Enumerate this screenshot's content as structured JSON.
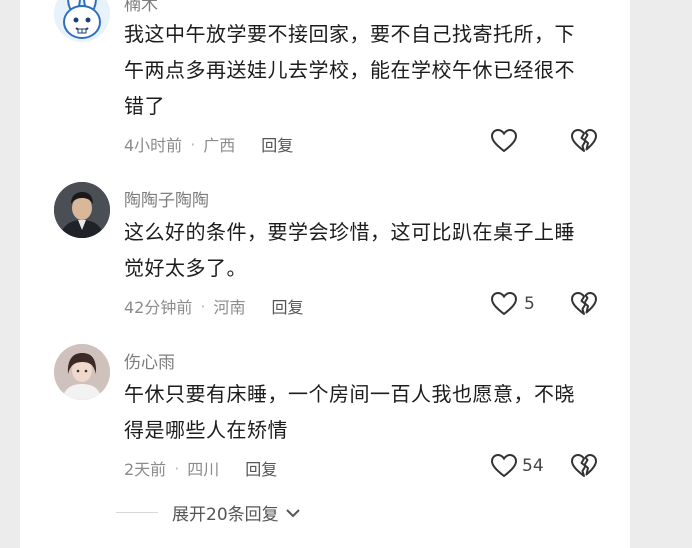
{
  "comments": [
    {
      "username": "楠木",
      "text": "我这中午放学要不接回家，要不自己找寄托所，下午两点多再送娃儿去学校，能在学校午休已经很不错了",
      "time": "4小时前",
      "location": "广西",
      "reply_label": "回复",
      "likes": ""
    },
    {
      "username": "陶陶子陶陶",
      "text": "这么好的条件，要学会珍惜，这可比趴在桌子上睡觉好太多了。",
      "time": "42分钟前",
      "location": "河南",
      "reply_label": "回复",
      "likes": "5"
    },
    {
      "username": "伤心雨",
      "text": "午休只要有床睡，一个房间一百人我也愿意，不晓得是哪些人在矫情",
      "time": "2天前",
      "location": "四川",
      "reply_label": "回复",
      "likes": "54"
    }
  ],
  "expand_label": "展开20条回复",
  "separator": "·"
}
